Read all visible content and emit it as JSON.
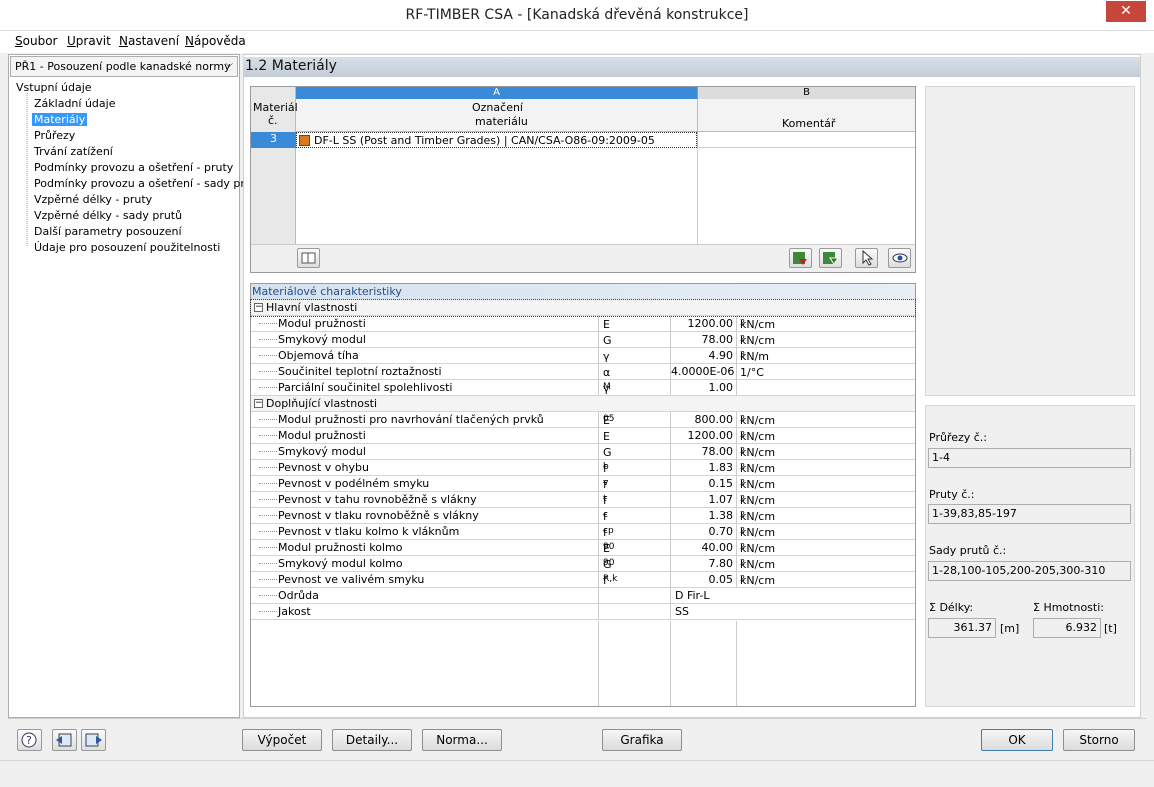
{
  "window": {
    "title": "RF-TIMBER CSA - [Kanadská dřevěná konstrukce]",
    "close": "✕"
  },
  "menu": [
    {
      "key": "S",
      "rest": "oubor"
    },
    {
      "key": "U",
      "rest": "pravit"
    },
    {
      "key": "N",
      "rest": "astavení"
    },
    {
      "key": "N",
      "rest": "ápověda"
    }
  ],
  "case_selector": "PŘ1 - Posouzení podle kanadské normy",
  "tree": {
    "root": "Vstupní údaje",
    "items": [
      "Základní údaje",
      "Materiály",
      "Průřezy",
      "Trvání zatížení",
      "Podmínky provozu a ošetření - pruty",
      "Podmínky provozu a ošetření - sady prutů",
      "Vzpěrné délky - pruty",
      "Vzpěrné délky - sady prutů",
      "Další parametry posouzení",
      "Údaje pro posouzení použitelnosti"
    ],
    "selected": 1
  },
  "section_title": "1.2 Materiály",
  "mat_table": {
    "col_a": "A",
    "col_b": "B",
    "h_num1": "Materiál",
    "h_num2": "č.",
    "h_a1": "Označení",
    "h_a2": "materiálu",
    "h_b": "Komentář",
    "rows": [
      {
        "num": "3",
        "name": "DF-L SS (Post and Timber Grades) | CAN/CSA-O86-09:2009-05",
        "comment": "",
        "color": "#d97a1a"
      }
    ]
  },
  "props_title": "Materiálové charakteristiky",
  "groups": [
    {
      "name": "Hlavní vlastnosti",
      "rows": [
        {
          "label": "Modul pružnosti",
          "sym": "E",
          "sub": "",
          "val": "1200.00",
          "unit": "kN/cm",
          "sup": "2"
        },
        {
          "label": "Smykový modul",
          "sym": "G",
          "sub": "",
          "val": "78.00",
          "unit": "kN/cm",
          "sup": "2"
        },
        {
          "label": "Objemová tíha",
          "sym": "γ",
          "sub": "",
          "val": "4.90",
          "unit": "kN/m",
          "sup": "3"
        },
        {
          "label": "Součinitel teplotní roztažnosti",
          "sym": "α",
          "sub": "",
          "val": "4.0000E-06",
          "unit": "1/°C",
          "sup": ""
        },
        {
          "label": "Parciální součinitel spolehlivosti",
          "sym": "γ",
          "sub": "M",
          "val": "1.00",
          "unit": "",
          "sup": ""
        }
      ]
    },
    {
      "name": "Doplňující vlastnosti",
      "rows": [
        {
          "label": "Modul pružnosti pro navrhování tlačených prvků",
          "sym": "E",
          "sub": "05",
          "val": "800.00",
          "unit": "kN/cm",
          "sup": "2"
        },
        {
          "label": "Modul pružnosti",
          "sym": "E",
          "sub": "",
          "val": "1200.00",
          "unit": "kN/cm",
          "sup": "2"
        },
        {
          "label": "Smykový modul",
          "sym": "G",
          "sub": "",
          "val": "78.00",
          "unit": "kN/cm",
          "sup": "2"
        },
        {
          "label": "Pevnost v ohybu",
          "sym": "f",
          "sub": "b",
          "val": "1.83",
          "unit": "kN/cm",
          "sup": "2"
        },
        {
          "label": "Pevnost v podélném smyku",
          "sym": "f",
          "sub": "v",
          "val": "0.15",
          "unit": "kN/cm",
          "sup": "2"
        },
        {
          "label": "Pevnost v tahu rovnoběžně s vlákny",
          "sym": "f",
          "sub": "t",
          "val": "1.07",
          "unit": "kN/cm",
          "sup": "2"
        },
        {
          "label": "Pevnost v tlaku rovnoběžně s vlákny",
          "sym": "f",
          "sub": "c",
          "val": "1.38",
          "unit": "kN/cm",
          "sup": "2"
        },
        {
          "label": "Pevnost v tlaku kolmo k vláknům",
          "sym": "f",
          "sub": "cp",
          "val": "0.70",
          "unit": "kN/cm",
          "sup": "2"
        },
        {
          "label": "Modul pružnosti kolmo",
          "sym": "E",
          "sub": "90",
          "val": "40.00",
          "unit": "kN/cm",
          "sup": "2"
        },
        {
          "label": "Smykový modul kolmo",
          "sym": "G",
          "sub": "90",
          "val": "7.80",
          "unit": "kN/cm",
          "sup": "2"
        },
        {
          "label": "Pevnost ve valivém smyku",
          "sym": "f",
          "sub": "R,k",
          "val": "0.05",
          "unit": "kN/cm",
          "sup": "2"
        }
      ]
    }
  ],
  "extra": [
    {
      "label": "Odrůda",
      "val": "D Fir-L"
    },
    {
      "label": "Jakost",
      "val": "SS"
    }
  ],
  "right": {
    "sections_label": "Průřezy č.:",
    "sections": "1-4",
    "members_label": "Pruty č.:",
    "members": "1-39,83,85-197",
    "sets_label": "Sady prutů č.:",
    "sets": "1-28,100-105,200-205,300-310",
    "len_label": "Σ Délky:",
    "len": "361.37",
    "len_unit": "[m]",
    "mass_label": "Σ Hmotnosti:",
    "mass": "6.932",
    "mass_unit": "[t]"
  },
  "buttons": {
    "calc": "Výpočet",
    "details": "Detaily...",
    "norm": "Norma...",
    "graphics": "Grafika",
    "ok": "OK",
    "cancel": "Storno"
  }
}
